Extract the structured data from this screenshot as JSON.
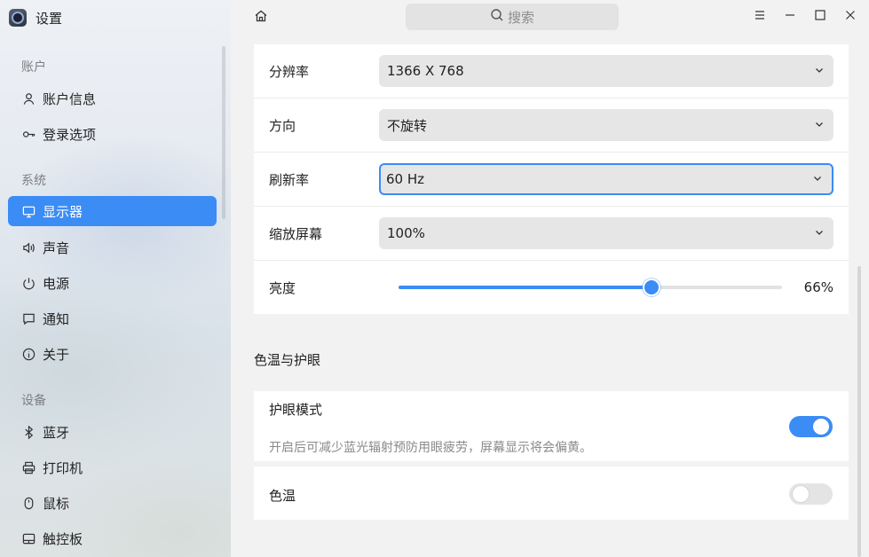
{
  "app": {
    "title": "设置"
  },
  "search": {
    "placeholder": "搜索"
  },
  "sidebar": {
    "sections": [
      {
        "label": "账户",
        "items": [
          {
            "label": "账户信息",
            "icon": "user-icon"
          },
          {
            "label": "登录选项",
            "icon": "key-icon"
          }
        ]
      },
      {
        "label": "系统",
        "items": [
          {
            "label": "显示器",
            "icon": "monitor-icon",
            "active": true
          },
          {
            "label": "声音",
            "icon": "speaker-icon"
          },
          {
            "label": "电源",
            "icon": "power-icon"
          },
          {
            "label": "通知",
            "icon": "message-icon"
          },
          {
            "label": "关于",
            "icon": "info-icon"
          }
        ]
      },
      {
        "label": "设备",
        "items": [
          {
            "label": "蓝牙",
            "icon": "bluetooth-icon"
          },
          {
            "label": "打印机",
            "icon": "printer-icon"
          },
          {
            "label": "鼠标",
            "icon": "mouse-icon"
          },
          {
            "label": "触控板",
            "icon": "touchpad-icon"
          }
        ]
      }
    ]
  },
  "display": {
    "resolution": {
      "label": "分辨率",
      "value": "1366 X 768"
    },
    "orientation": {
      "label": "方向",
      "value": "不旋转"
    },
    "refresh_rate": {
      "label": "刷新率",
      "value": "60 Hz"
    },
    "scale": {
      "label": "缩放屏幕",
      "value": "100%"
    },
    "brightness": {
      "label": "亮度",
      "value": "66%",
      "level": 0.66
    }
  },
  "eye_care": {
    "section_title": "色温与护眼",
    "eye_mode": {
      "label": "护眼模式",
      "description": "开启后可减少蓝光辐射预防用眼疲劳，屏幕显示将会偏黄。",
      "enabled": true
    },
    "color_temp": {
      "label": "色温",
      "enabled": false
    }
  },
  "colors": {
    "accent": "#3b8cf5"
  }
}
